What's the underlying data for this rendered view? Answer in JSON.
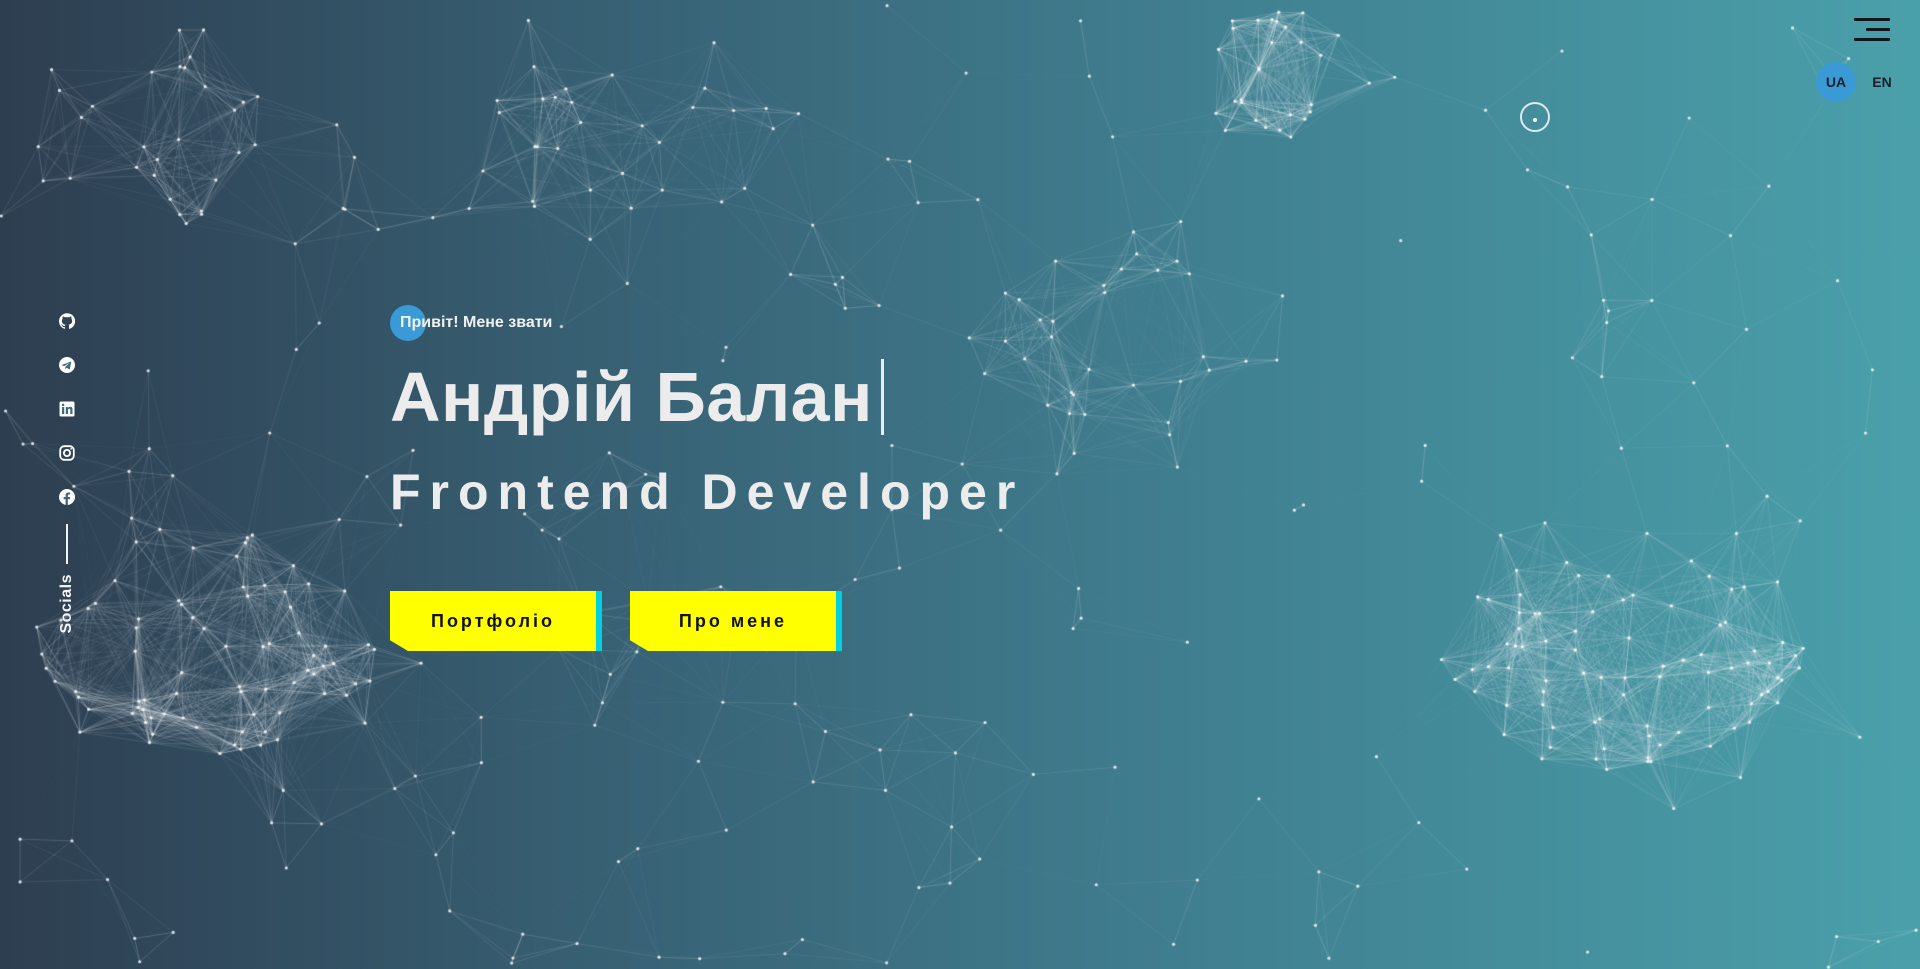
{
  "nav": {
    "menu_icon": "hamburger-menu-icon",
    "languages": [
      {
        "code": "UA",
        "active": true
      },
      {
        "code": "EN",
        "active": false
      }
    ]
  },
  "socials": {
    "label": "Socials",
    "items": [
      {
        "name": "github",
        "icon": "github-icon"
      },
      {
        "name": "telegram",
        "icon": "telegram-icon"
      },
      {
        "name": "linkedin",
        "icon": "linkedin-icon"
      },
      {
        "name": "instagram",
        "icon": "instagram-icon"
      },
      {
        "name": "facebook",
        "icon": "facebook-icon"
      }
    ]
  },
  "hero": {
    "greeting": "Привіт! Мене звати",
    "name": "Андрій Балан",
    "role": "Frontend Developer",
    "buttons": {
      "portfolio": "Портфоліо",
      "about": "Про мене"
    }
  },
  "colors": {
    "accent_blue": "#3a9ad6",
    "button_yellow": "#ffff00",
    "button_accent": "#00d0e0",
    "text": "#ececec"
  }
}
